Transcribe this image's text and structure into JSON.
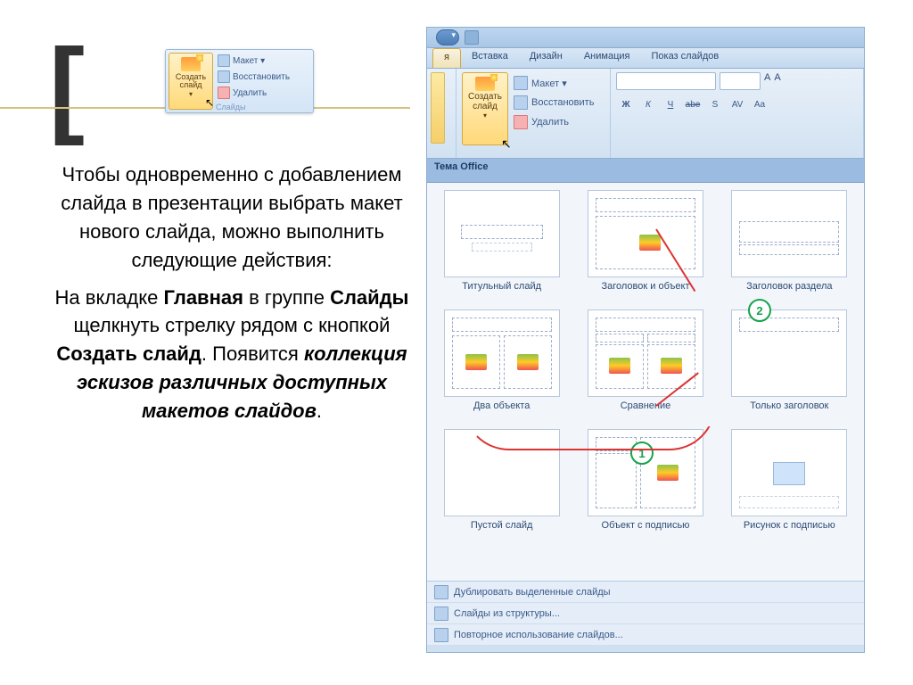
{
  "body_text": {
    "p1a": "Чтобы одновременно с добавлением слайда в презентации выбрать макет нового слайда, можно выполнить следующие действия:",
    "p2a": "На вкладке ",
    "p2b": "Главная",
    "p2c": " в группе ",
    "p2d": "Слайды",
    "p2e": " щелкнуть стрелку рядом с кнопкой ",
    "p2f": "Создать слайд",
    "p2g": ". Появится ",
    "p2h": "коллекция эскизов различных доступных макетов слайдов",
    "p2i": "."
  },
  "small_ribbon": {
    "create_line1": "Создать",
    "create_line2": "слайд",
    "layout": "Макет",
    "restore": "Восстановить",
    "delete": "Удалить",
    "group": "Слайды"
  },
  "ribbon": {
    "tabs": [
      "я",
      "Вставка",
      "Дизайн",
      "Анимация",
      "Показ слайдов"
    ],
    "active_tab_idx": 0,
    "create_line1": "Создать",
    "create_line2": "слайд",
    "layout": "Макет",
    "restore": "Восстановить",
    "delete": "Удалить",
    "font_btns": [
      "Ж",
      "К",
      "Ч",
      "abe",
      "S",
      "AV",
      "Aa"
    ]
  },
  "gallery": {
    "header": "Тема Office",
    "layouts": [
      "Титульный слайд",
      "Заголовок и объект",
      "Заголовок раздела",
      "Два объекта",
      "Сравнение",
      "Только заголовок",
      "Пустой слайд",
      "Объект с подписью",
      "Рисунок с подписью"
    ],
    "callouts": {
      "c1": "1",
      "c2": "2"
    }
  },
  "footer": {
    "dup": "Дублировать выделенные слайды",
    "outline": "Слайды из структуры...",
    "reuse": "Повторное использование слайдов..."
  }
}
